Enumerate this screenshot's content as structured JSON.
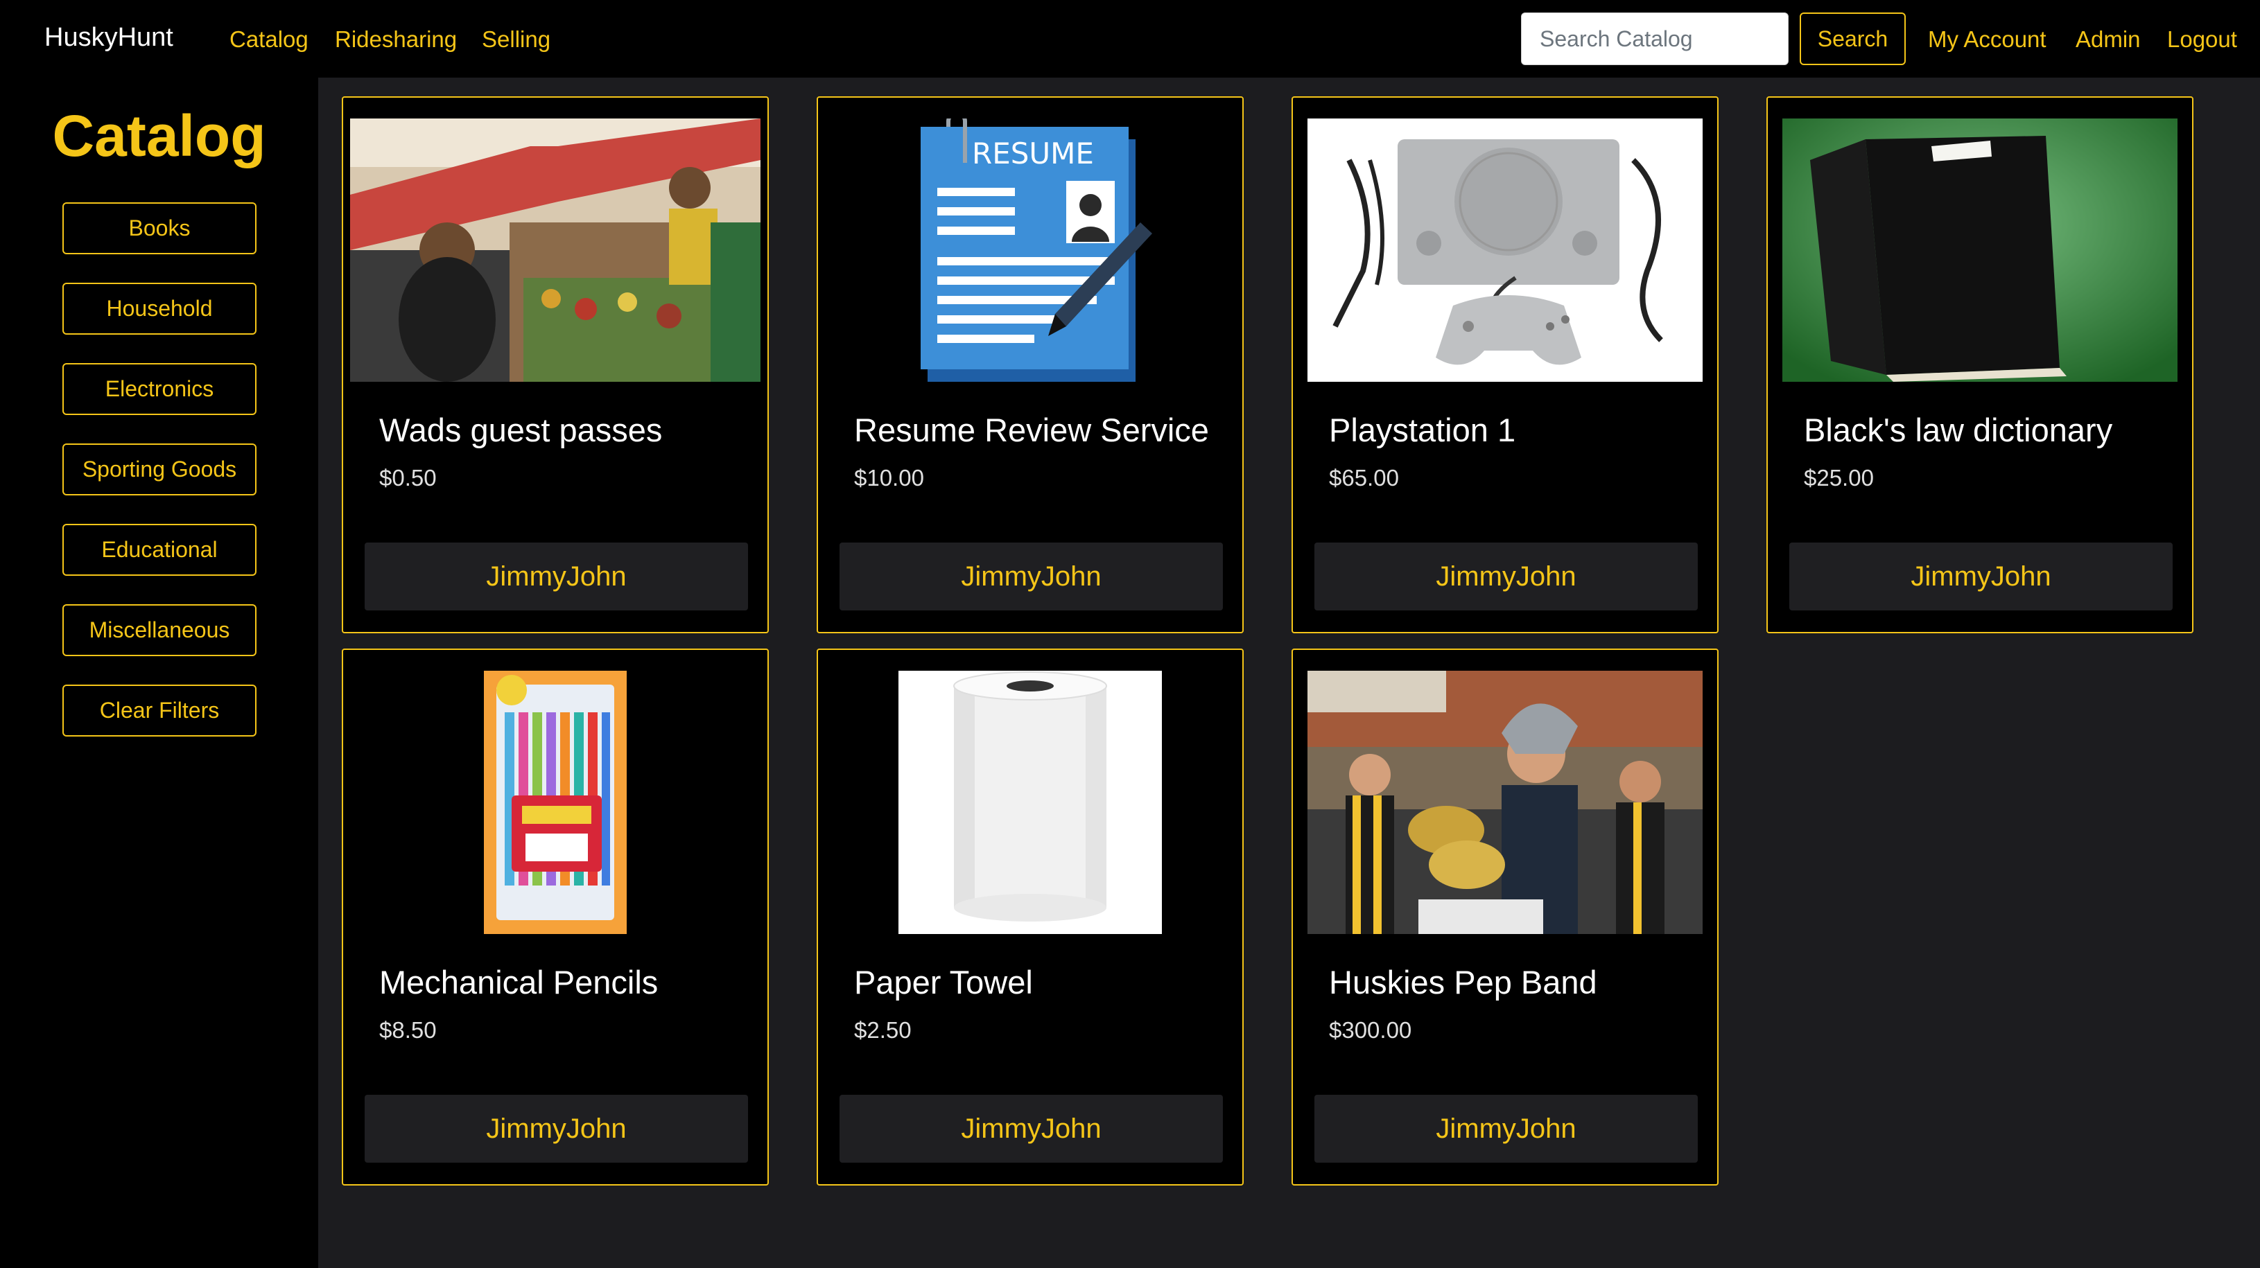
{
  "navbar": {
    "brand": "HuskyHunt",
    "links": [
      "Catalog",
      "Ridesharing",
      "Selling"
    ],
    "search_placeholder": "Search Catalog",
    "search_button": "Search",
    "right_links": [
      "My Account",
      "Admin",
      "Logout"
    ],
    "accent_color": "#f5c518"
  },
  "sidebar": {
    "title": "Catalog",
    "categories": [
      "Books",
      "Household",
      "Electronics",
      "Sporting Goods",
      "Educational",
      "Miscellaneous",
      "Clear Filters"
    ]
  },
  "items": [
    {
      "title": "Wads guest passes",
      "price": "$0.50",
      "seller": "JimmyJohn",
      "image": "cafeteria-photo"
    },
    {
      "title": "Resume Review Service",
      "price": "$10.00",
      "seller": "JimmyJohn",
      "image": "resume-icon",
      "image_text": "RESUME"
    },
    {
      "title": "Playstation 1",
      "price": "$65.00",
      "seller": "JimmyJohn",
      "image": "playstation-photo"
    },
    {
      "title": "Black's law dictionary",
      "price": "$25.00",
      "seller": "JimmyJohn",
      "image": "dictionary-photo"
    },
    {
      "title": "Mechanical Pencils",
      "price": "$8.50",
      "seller": "JimmyJohn",
      "image": "pencils-photo"
    },
    {
      "title": "Paper Towel",
      "price": "$2.50",
      "seller": "JimmyJohn",
      "image": "paper-towel-photo"
    },
    {
      "title": "Huskies Pep Band",
      "price": "$300.00",
      "seller": "JimmyJohn",
      "image": "pep-band-photo"
    }
  ]
}
